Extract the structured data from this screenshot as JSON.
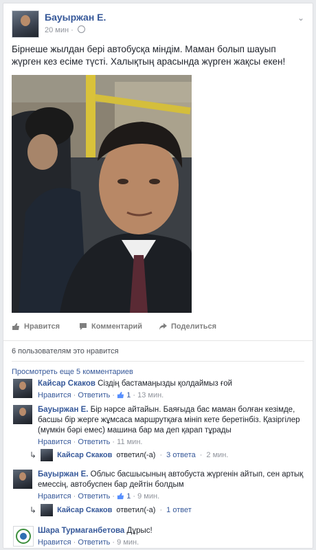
{
  "post": {
    "author": "Бауыржан Е.",
    "time": "20 мин",
    "dot": "·",
    "text": "Бірнеше жылдан бері автобусқа міндім. Маман болып шауып жүрген кез есіме түсті. Халықтың арасында жүрген жақсы екен!"
  },
  "actions": {
    "like": "Нравится",
    "comment": "Комментарий",
    "share": "Поделиться"
  },
  "likes_text": "6 пользователям это нравится",
  "view_more": "Просмотреть еще 5 комментариев",
  "comments": [
    {
      "name": "Кайсар Скаков",
      "text": "Сіздің бастамаңызды қолдаймыз ғой",
      "like": "Нравится",
      "reply": "Ответить",
      "likes": "1",
      "time": "13 мин."
    },
    {
      "name": "Бауыржан Е.",
      "text": "Бір нәрсе айтайын. Баяғыда бас маман болған кезімде, басшы бір жерге жұмсаса маршрутқаға мініп кете беретінбіз. Қазіргілер (мүмкін бәрі емес) машина бар ма деп қарап тұрады",
      "like": "Нравится",
      "reply": "Ответить",
      "time": "11 мин.",
      "reply_summary": {
        "name": "Кайсар Скаков",
        "verb": "ответил(-а)",
        "link": "3 ответа",
        "time": "2 мин."
      }
    },
    {
      "name": "Бауыржан Е.",
      "text": "Облыс басшысының автобуста жүргенін айтып, сен артық емессің, автобуспен бар дейтін болдым",
      "like": "Нравится",
      "reply": "Ответить",
      "likes": "1",
      "time": "9 мин.",
      "reply_summary": {
        "name": "Кайсар Скаков",
        "verb": "ответил(-а)",
        "link": "1 ответ"
      }
    },
    {
      "name": "Шара Турмаганбетова",
      "text": "Дұрыс!",
      "like": "Нравится",
      "reply": "Ответить",
      "time": "9 мин."
    }
  ],
  "colors": {
    "link": "#365899",
    "meta": "#90949c",
    "text": "#1d2129",
    "background": "#e9ebee"
  }
}
